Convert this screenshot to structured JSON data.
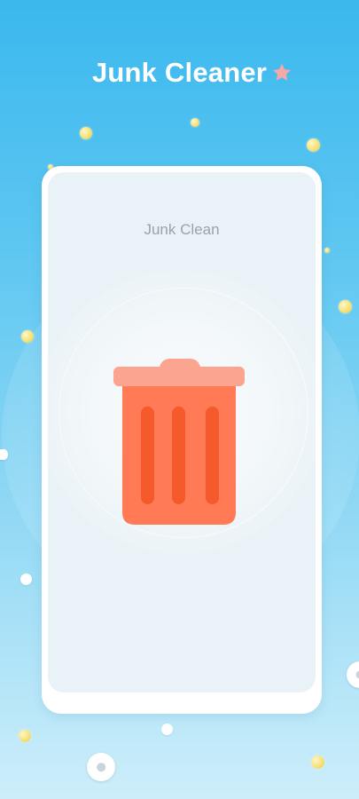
{
  "header": {
    "title": "Junk Cleaner",
    "star_icon": "star-icon"
  },
  "card": {
    "label": "Junk Clean",
    "icon": "trash-can-icon"
  },
  "colors": {
    "background_top": "#3bb8ee",
    "background_bottom": "#cdeefa",
    "trash_body": "#ff7a55",
    "trash_lid": "#fba590",
    "trash_stripes": "#f55a2a",
    "star": "#f4a9a8"
  }
}
